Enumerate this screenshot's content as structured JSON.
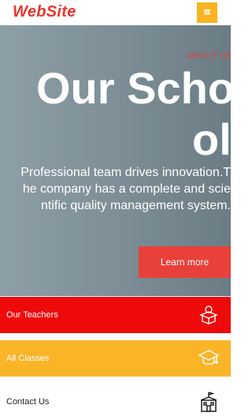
{
  "header": {
    "logo": "WebSite",
    "menu_icon": "hamburger-menu-icon"
  },
  "hero": {
    "eyebrow": "ABOUT US",
    "title_line1": "Our Scho",
    "title_line2": "ol",
    "text_lines": [
      "Professional team drives innovation.T",
      "he company has a complete and scie",
      "ntific quality management system."
    ],
    "button_label": "Learn more"
  },
  "nav_rows": [
    {
      "label": "Our Teachers",
      "icon": "teacher-icon",
      "color": "#ee0a0a"
    },
    {
      "label": "All Classes",
      "icon": "graduation-cap-icon",
      "color": "#f9b427"
    },
    {
      "label": "Contact Us",
      "icon": "school-building-icon",
      "color": "#ffffff"
    }
  ],
  "colors": {
    "brand_red": "#e8352f",
    "accent_yellow": "#f8b420",
    "button_red": "#e8413a"
  }
}
